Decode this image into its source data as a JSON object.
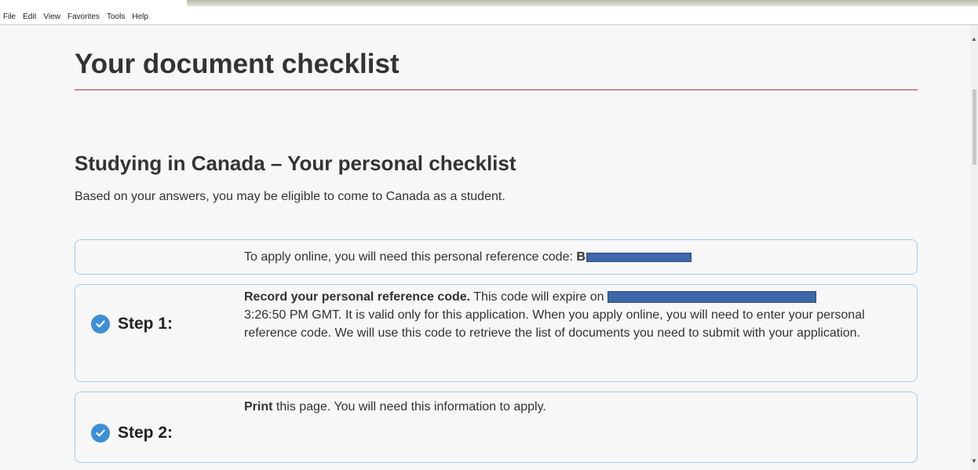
{
  "menubar": {
    "items": [
      "File",
      "Edit",
      "View",
      "Favorites",
      "Tools",
      "Help"
    ]
  },
  "page": {
    "title": "Your document checklist",
    "section_title": "Studying in Canada – Your personal checklist",
    "intro": "Based on your answers, you may be eligible to come to Canada as a student."
  },
  "reference_panel": {
    "text": "To apply online, you will need this personal reference code: ",
    "code_visible": "B"
  },
  "step1": {
    "label": "Step 1:",
    "bold_text": "Record your personal reference code.",
    "text_before_redaction": " This code will expire on ",
    "text_after": "3:26:50 PM GMT. It is valid only for this application. When you apply online, you will need to enter your personal reference code. We will use this code to retrieve the list of documents you need to submit with your application."
  },
  "step2": {
    "label": "Step 2:",
    "bold_text": "Print",
    "text": " this page. You will need this information to apply."
  },
  "colors": {
    "rule": "#af3c43",
    "panel_border": "#9ecbef",
    "check": "#3d8fd6",
    "redaction": "#3e67a9"
  }
}
